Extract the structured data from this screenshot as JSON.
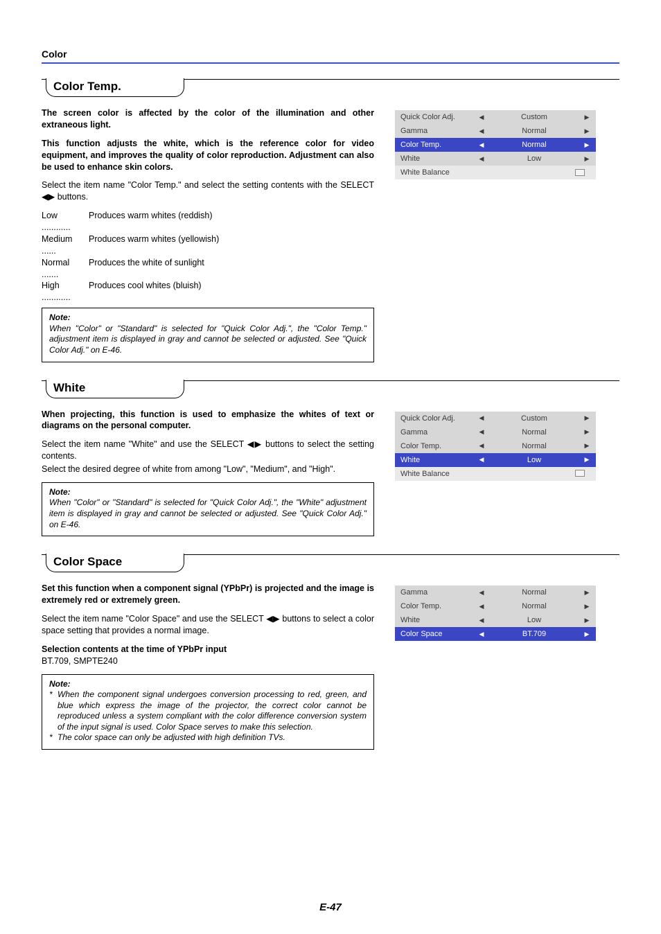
{
  "header": {
    "title": "Color"
  },
  "footer": {
    "page": "E-47"
  },
  "sections": {
    "colorTemp": {
      "heading": "Color Temp.",
      "intro1": "The screen color is affected by the color of the illumination and other extraneous light.",
      "intro2": "This function adjusts the white, which is the reference color for video equipment, and improves the quality of color reproduction. Adjustment can also be used to enhance skin colors.",
      "select": "Select the item name \"Color Temp.\" and select the setting contents with the SELECT ◀▶ buttons.",
      "options": {
        "low": {
          "label": "Low ............",
          "desc": "Produces warm whites (reddish)"
        },
        "medium": {
          "label": "Medium ......",
          "desc": "Produces warm whites (yellowish)"
        },
        "normal": {
          "label": "Normal .......",
          "desc": "Produces the white of sunlight"
        },
        "high": {
          "label": "High ............",
          "desc": "Produces cool whites (bluish)"
        }
      },
      "noteLabel": "Note:",
      "note": "When \"Color\" or \"Standard\" is selected for \"Quick Color Adj.\", the \"Color Temp.\" adjustment item is displayed in gray and cannot be selected or adjusted. See \"Quick Color Adj.\" on E-46.",
      "menu": {
        "r0": {
          "label": "Quick Color Adj.",
          "value": "Custom"
        },
        "r1": {
          "label": "Gamma",
          "value": "Normal"
        },
        "r2": {
          "label": "Color Temp.",
          "value": "Normal",
          "selected": true
        },
        "r3": {
          "label": "White",
          "value": "Low"
        },
        "r4": {
          "label": "White Balance"
        }
      }
    },
    "white": {
      "heading": "White",
      "intro": "When projecting, this function is used to emphasize the whites of text or diagrams on the personal computer.",
      "select1": "Select the item name \"White\" and use the SELECT ◀▶ buttons to select the setting contents.",
      "select2": "Select the desired degree of white from among \"Low\", \"Medium\", and \"High\".",
      "noteLabel": "Note:",
      "note": "When \"Color\" or \"Standard\" is selected for \"Quick Color Adj.\", the \"White\" adjustment item is displayed in gray and cannot be selected or adjusted. See \"Quick Color Adj.\" on E-46.",
      "menu": {
        "r0": {
          "label": "Quick Color Adj.",
          "value": "Custom"
        },
        "r1": {
          "label": "Gamma",
          "value": "Normal"
        },
        "r2": {
          "label": "Color Temp.",
          "value": "Normal"
        },
        "r3": {
          "label": "White",
          "value": "Low",
          "selected": true
        },
        "r4": {
          "label": "White Balance"
        }
      }
    },
    "colorSpace": {
      "heading": "Color Space",
      "intro": "Set this function when a component signal (YPbPr) is projected and the image is extremely red or extremely green.",
      "select": "Select the item name \"Color Space\" and use the SELECT ◀▶ buttons to select a color space setting that provides a normal image.",
      "subhead": "Selection contents at the time of YPbPr input",
      "subval": "BT.709, SMPTE240",
      "noteLabel": "Note:",
      "note1": "When the component signal undergoes conversion processing to red, green, and blue which express the image of the projector, the correct color cannot be reproduced unless a system compliant with the color difference conversion system of the input signal is used. Color Space serves to make this selection.",
      "note2": "The color space can only be adjusted with high definition TVs.",
      "menu": {
        "r0": {
          "label": "Gamma",
          "value": "Normal"
        },
        "r1": {
          "label": "Color Temp.",
          "value": "Normal"
        },
        "r2": {
          "label": "White",
          "value": "Low"
        },
        "r3": {
          "label": "Color Space",
          "value": "BT.709",
          "selected": true
        }
      }
    }
  }
}
